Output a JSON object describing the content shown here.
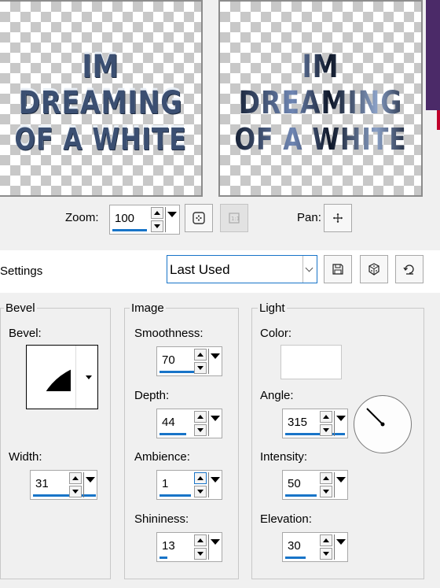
{
  "preview": {
    "left_text": [
      "IM",
      "DREAMING",
      "OF A WHITE"
    ],
    "right_text": [
      "IM",
      "DREAMING",
      "OF A WHITE"
    ]
  },
  "zoom": {
    "label": "Zoom:",
    "value": "100",
    "pan_label": "Pan:"
  },
  "settings": {
    "label": "Settings",
    "preset": "Last Used"
  },
  "bevel_group": {
    "title": "Bevel",
    "bevel_label": "Bevel:",
    "width_label": "Width:",
    "width": "31"
  },
  "image_group": {
    "title": "Image",
    "smoothness_label": "Smoothness:",
    "smoothness": "70",
    "depth_label": "Depth:",
    "depth": "44",
    "ambience_label": "Ambience:",
    "ambience": "1",
    "shininess_label": "Shininess:",
    "shininess": "13"
  },
  "light_group": {
    "title": "Light",
    "color_label": "Color:",
    "color": "#ffffff",
    "angle_label": "Angle:",
    "angle": "315",
    "intensity_label": "Intensity:",
    "intensity": "50",
    "elevation_label": "Elevation:",
    "elevation": "30"
  }
}
